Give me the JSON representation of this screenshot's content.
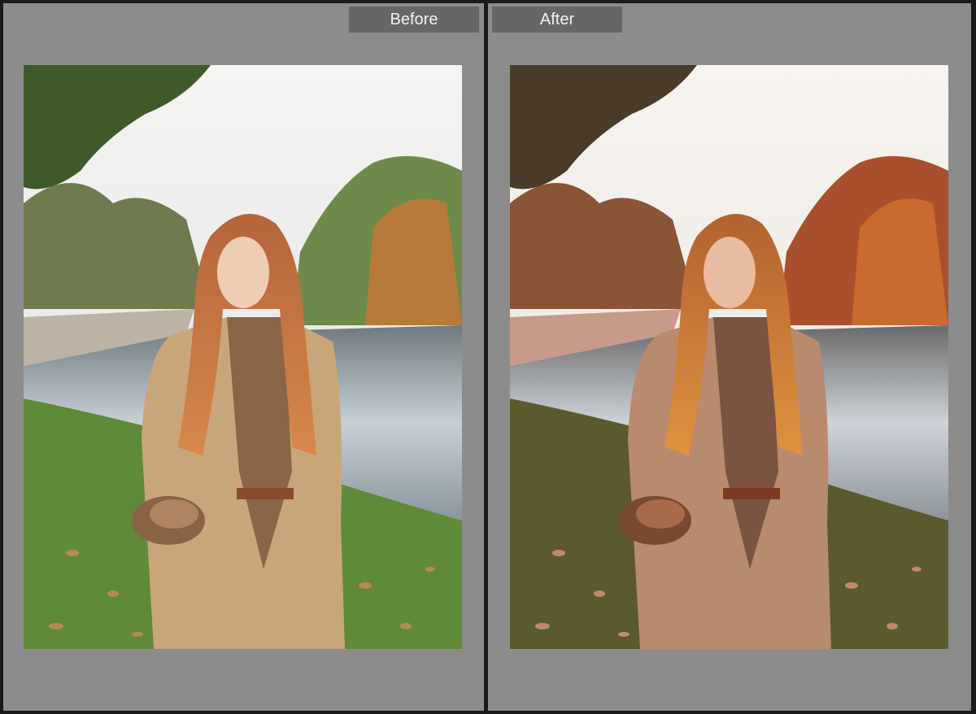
{
  "panels": {
    "before": {
      "label": "Before"
    },
    "after": {
      "label": "After"
    }
  },
  "colors": {
    "background": "#8c8c8c",
    "label_tab": "#666666",
    "label_text": "#f2f2f2",
    "divider": "#1a1a1a"
  }
}
